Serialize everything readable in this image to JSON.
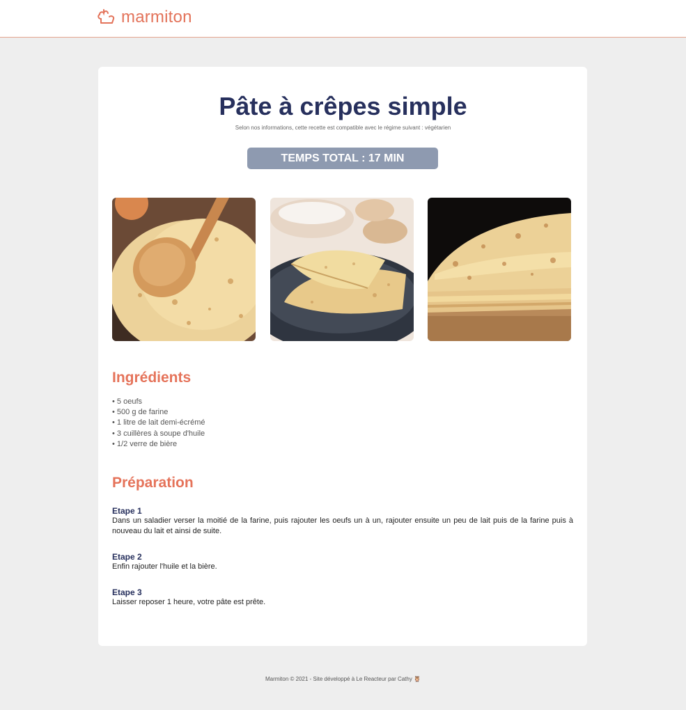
{
  "header": {
    "logo_text": "marmiton",
    "logo_icon": "chef-hat-icon"
  },
  "recipe": {
    "title": "Pâte à crêpes simple",
    "diet_note": "Selon nos informations, cette recette est compatible avec le régime suivant : végétarien",
    "total_time": "TEMPS TOTAL : 17 MIN"
  },
  "ingredients": {
    "title": "Ingrédients",
    "items": [
      "5 oeufs",
      "500 g de farine",
      "1 litre de lait demi-écrémé",
      "3 cuillères à soupe d'huile",
      "1/2 verre de bière"
    ]
  },
  "preparation": {
    "title": "Préparation",
    "steps": [
      {
        "title": "Etape 1",
        "text": "Dans un saladier verser la moitié de la farine, puis rajouter les oeufs un à un, rajouter ensuite un peu de lait puis de la farine puis à nouveau du lait et ainsi de suite."
      },
      {
        "title": "Etape 2",
        "text": "Enfin rajouter l'huile et la bière."
      },
      {
        "title": "Etape 3",
        "text": "Laisser reposer 1 heure, votre pâte est prête."
      }
    ]
  },
  "footer": {
    "text": "Marmiton © 2021 - Site développé à Le Reacteur par Cathy 🦉"
  },
  "colors": {
    "brand": "#e3735a",
    "title": "#27305d",
    "badge": "#8e9ab0",
    "background": "#eeeeee"
  }
}
